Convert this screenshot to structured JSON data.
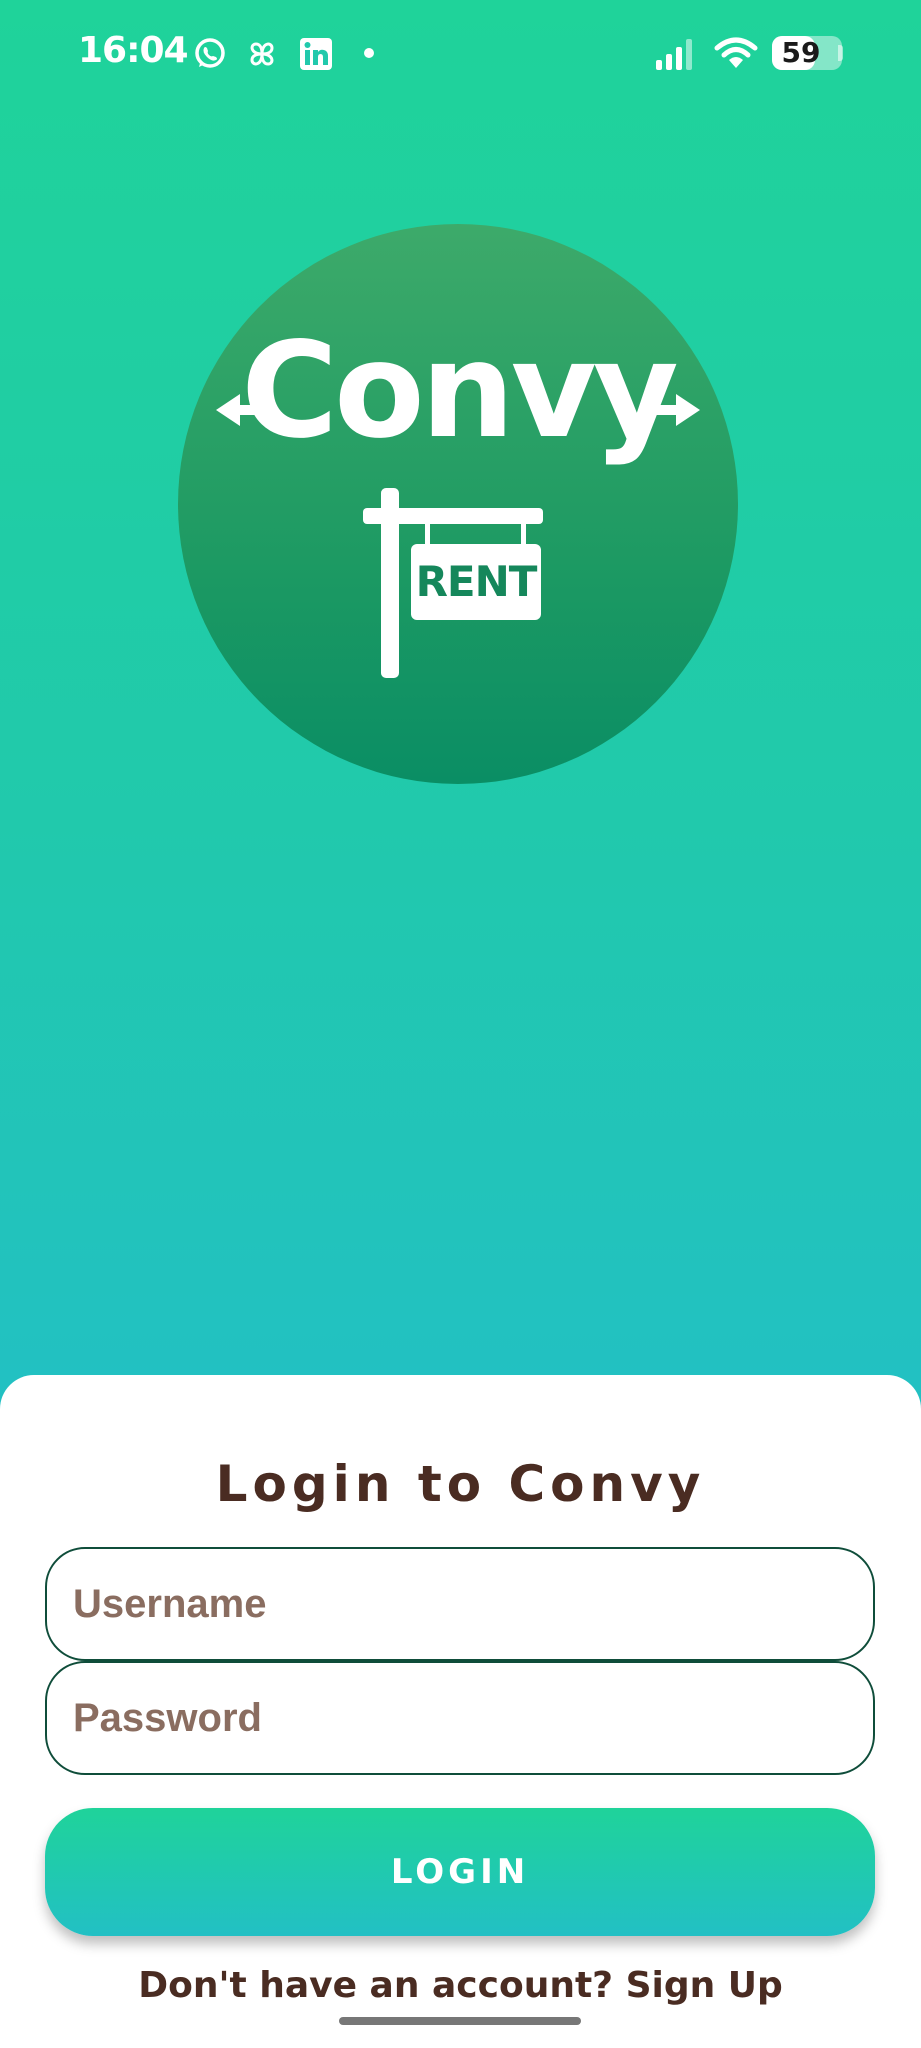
{
  "status_bar": {
    "time": "16:04",
    "battery": "59",
    "notification_icons": [
      "whatsapp-icon",
      "pinwheel-icon",
      "linkedin-icon",
      "dot-icon"
    ],
    "system_icons": [
      "signal-icon",
      "wifi-icon",
      "battery-icon"
    ]
  },
  "logo": {
    "brand": "Convy",
    "sign_text": "RENT"
  },
  "login": {
    "title": "Login to Convy",
    "username_placeholder": "Username",
    "password_placeholder": "Password",
    "button_label": "LOGIN",
    "signup_prompt": "Don't have an account? Sign Up"
  },
  "colors": {
    "gradient_top": "#1fd39a",
    "gradient_bottom": "#22c0c4",
    "logo_green": "#1d9a63",
    "text_brown": "#4a2c22",
    "field_border": "#0f4d3a"
  }
}
